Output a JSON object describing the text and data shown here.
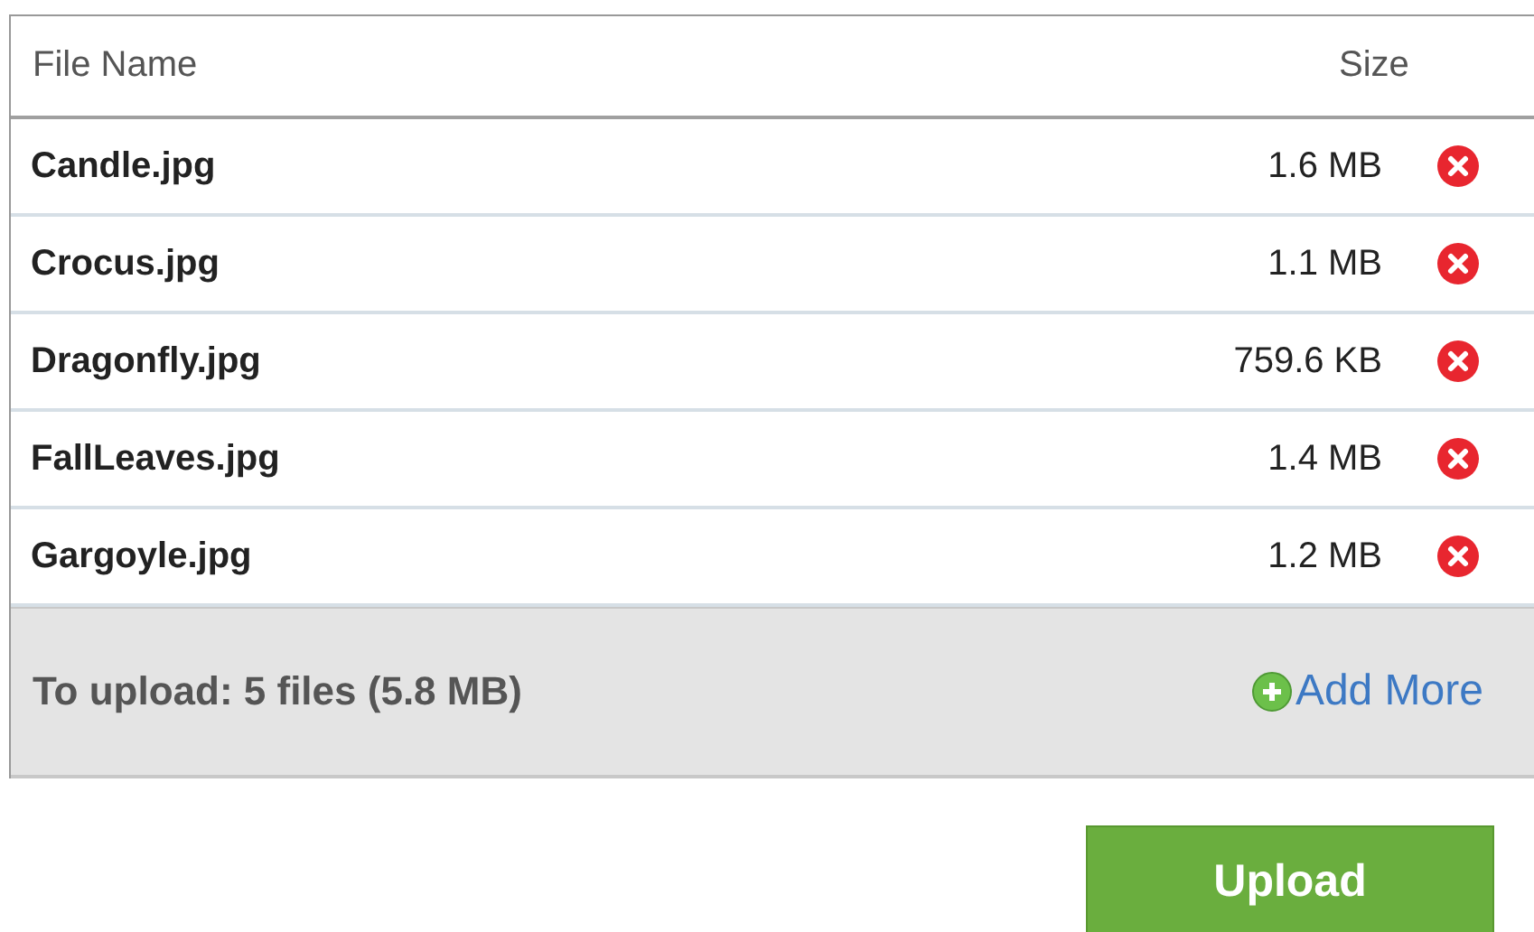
{
  "table": {
    "columns": [
      {
        "label": "File Name"
      },
      {
        "label": "Size"
      }
    ],
    "rows": [
      {
        "name": "Candle.jpg",
        "size": "1.6 MB"
      },
      {
        "name": "Crocus.jpg",
        "size": "1.1 MB"
      },
      {
        "name": "Dragonfly.jpg",
        "size": "759.6 KB"
      },
      {
        "name": "FallLeaves.jpg",
        "size": "1.4 MB"
      },
      {
        "name": "Gargoyle.jpg",
        "size": "1.2 MB"
      }
    ]
  },
  "summary": {
    "text": "To upload: 5 files (5.8 MB)",
    "add_link": "Add More"
  },
  "buttons": [
    "Upload"
  ]
}
